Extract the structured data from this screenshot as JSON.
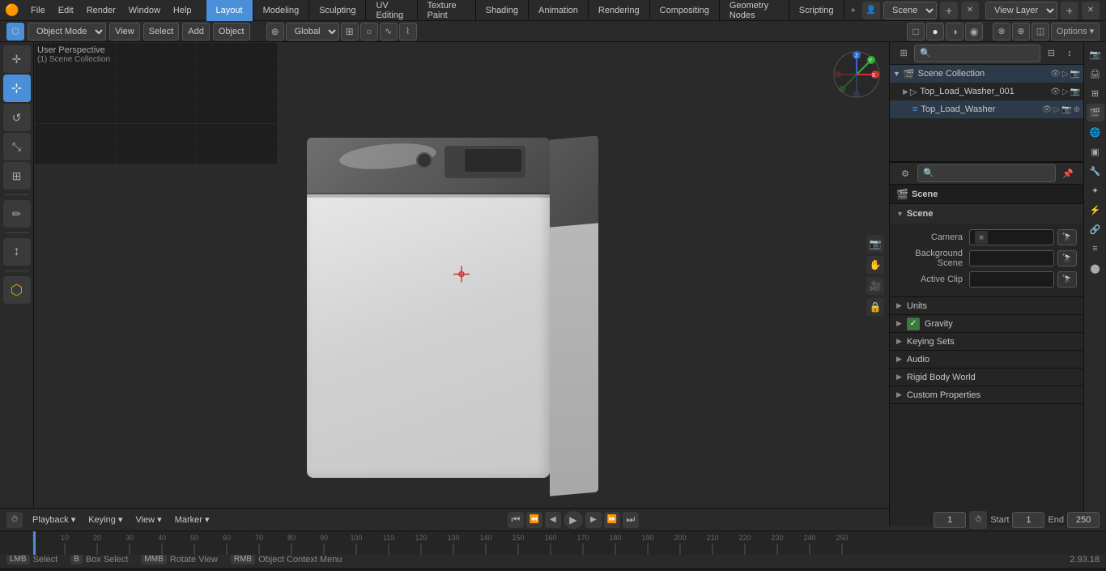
{
  "app": {
    "title": "Blender",
    "version": "2.93.18"
  },
  "menubar": {
    "logo": "🟠",
    "items": [
      "File",
      "Edit",
      "Render",
      "Window",
      "Help"
    ]
  },
  "workspace_tabs": [
    {
      "label": "Layout",
      "active": true
    },
    {
      "label": "Modeling"
    },
    {
      "label": "Sculpting"
    },
    {
      "label": "UV Editing"
    },
    {
      "label": "Texture Paint"
    },
    {
      "label": "Shading"
    },
    {
      "label": "Animation"
    },
    {
      "label": "Rendering"
    },
    {
      "label": "Compositing"
    },
    {
      "label": "Geometry Nodes"
    },
    {
      "label": "Scripting"
    }
  ],
  "top_right": {
    "scene_label": "Scene",
    "view_layer_label": "View Layer"
  },
  "viewport": {
    "mode": "Object Mode",
    "view_label": "View",
    "select_label": "Select",
    "add_label": "Add",
    "object_label": "Object",
    "perspective_label": "User Perspective",
    "scene_collection_label": "(1) Scene Collection",
    "shading_wireframe": "☐",
    "shading_solid": "●",
    "shading_material": "◑",
    "shading_rendered": "◉",
    "options_label": "Options",
    "transform": "Global"
  },
  "left_tools": [
    {
      "name": "cursor-tool",
      "icon": "✛",
      "active": false
    },
    {
      "name": "move-tool",
      "icon": "↔",
      "active": true
    },
    {
      "name": "rotate-tool",
      "icon": "↺",
      "active": false
    },
    {
      "name": "scale-tool",
      "icon": "⤡",
      "active": false
    },
    {
      "name": "transform-tool",
      "icon": "⊞",
      "active": false
    },
    {
      "name": "annotate-tool",
      "icon": "✏",
      "active": false
    },
    {
      "name": "measure-tool",
      "icon": "📐",
      "active": false
    },
    {
      "name": "add-cube-tool",
      "icon": "⬡",
      "active": false
    }
  ],
  "outliner": {
    "title": "Scene Collection",
    "items": [
      {
        "name": "Top_Load_Washer_001",
        "icon": "▷",
        "indent": 1,
        "expanded": false,
        "type": "object"
      },
      {
        "name": "Top_Load_Washer",
        "icon": "≡",
        "indent": 2,
        "expanded": false,
        "type": "mesh"
      }
    ]
  },
  "properties": {
    "scene_label": "Scene",
    "sections": [
      {
        "id": "scene-section",
        "title": "Scene",
        "expanded": true,
        "rows": [
          {
            "label": "Camera",
            "value": "",
            "has_dropper": true
          },
          {
            "label": "Background Scene",
            "value": "",
            "has_dropper": true
          },
          {
            "label": "Active Clip",
            "value": "",
            "has_dropper": true
          }
        ]
      },
      {
        "id": "units-section",
        "title": "Units",
        "expanded": false,
        "rows": []
      },
      {
        "id": "gravity-section",
        "title": "Gravity",
        "expanded": false,
        "has_checkbox": true,
        "rows": []
      },
      {
        "id": "keying-sets-section",
        "title": "Keying Sets",
        "expanded": false,
        "rows": []
      },
      {
        "id": "audio-section",
        "title": "Audio",
        "expanded": false,
        "rows": []
      },
      {
        "id": "rigid-body-world-section",
        "title": "Rigid Body World",
        "expanded": false,
        "rows": []
      },
      {
        "id": "custom-properties-section",
        "title": "Custom Properties",
        "expanded": false,
        "rows": []
      }
    ]
  },
  "prop_icons": [
    {
      "name": "render-icon",
      "icon": "📷",
      "active": false
    },
    {
      "name": "output-icon",
      "icon": "🖨",
      "active": false
    },
    {
      "name": "view-layer-icon",
      "icon": "⊞",
      "active": false
    },
    {
      "name": "scene-icon",
      "icon": "🎬",
      "active": true
    },
    {
      "name": "world-icon",
      "icon": "🌐",
      "active": false
    },
    {
      "name": "object-icon",
      "icon": "▣",
      "active": false
    },
    {
      "name": "modifier-icon",
      "icon": "🔧",
      "active": false
    },
    {
      "name": "particles-icon",
      "icon": "✦",
      "active": false
    },
    {
      "name": "physics-icon",
      "icon": "⚡",
      "active": false
    },
    {
      "name": "constraints-icon",
      "icon": "🔗",
      "active": false
    },
    {
      "name": "data-icon",
      "icon": "📊",
      "active": false
    },
    {
      "name": "material-icon",
      "icon": "⬤",
      "active": false
    }
  ],
  "timeline": {
    "playback_label": "Playback",
    "keying_label": "Keying",
    "view_label": "View",
    "marker_label": "Marker",
    "frame_current": "1",
    "frame_start_label": "Start",
    "frame_start": "1",
    "frame_end_label": "End",
    "frame_end": "250"
  },
  "status_bar": {
    "select_label": "Select",
    "select_key": "LMB",
    "box_select_label": "Box Select",
    "box_select_key": "B",
    "rotate_label": "Rotate View",
    "rotate_key": "MMB",
    "context_label": "Object Context Menu",
    "context_key": "RMB",
    "version": "2.93.18"
  }
}
